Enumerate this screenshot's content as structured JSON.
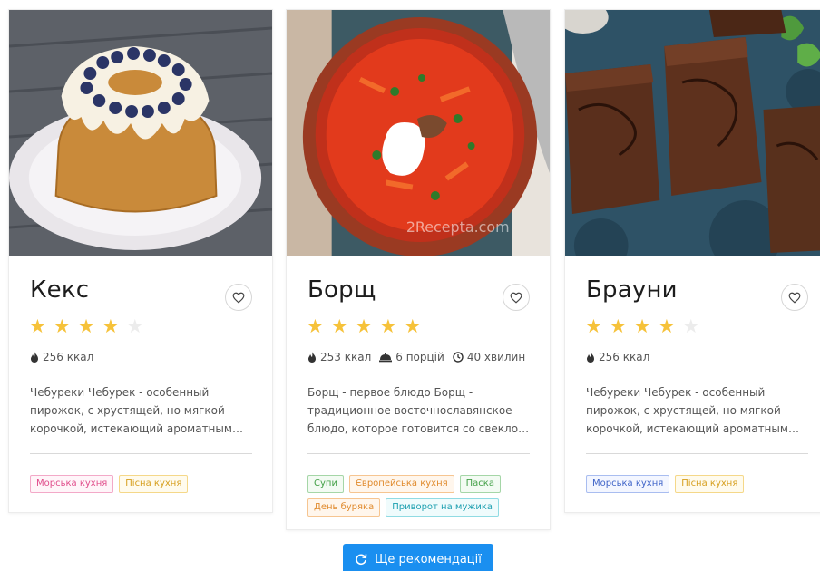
{
  "cards": [
    {
      "title": "Кекс",
      "rating": 4,
      "meta": {
        "calories": "256 ккал"
      },
      "description": "Чебуреки Чебурек - особенный пирожок, с хрустящей, но мягкой корочкой, истекающий ароматным соком, с сочно...",
      "tags": [
        "Морська кухня",
        "Пісна кухня"
      ]
    },
    {
      "title": "Борщ",
      "rating": 5,
      "meta": {
        "calories": "253 ккал",
        "portions": "6 порцій",
        "time": "40 хвилин"
      },
      "description": "Борщ - первое блюдо Борщ - традиционное восточнославянское блюдо, которое готовится со свеклой, ч...",
      "tags": [
        "Супи",
        "Європейська кухня",
        "Паска",
        "День буряка",
        "Приворот на мужика"
      ],
      "watermark": "2Recepta.com"
    },
    {
      "title": "Брауни",
      "rating": 4,
      "meta": {
        "calories": "256 ккал"
      },
      "description": "Чебуреки Чебурек - особенный пирожок, с хрустящей, но мягкой корочкой, истекающий ароматным соком, с сочно...",
      "tags": [
        "Морська кухня",
        "Пісна кухня"
      ]
    }
  ],
  "more_button": {
    "label": "Ще рекомендації"
  },
  "colors": {
    "star": "#f6c23a",
    "button": "#1a8ff0"
  }
}
